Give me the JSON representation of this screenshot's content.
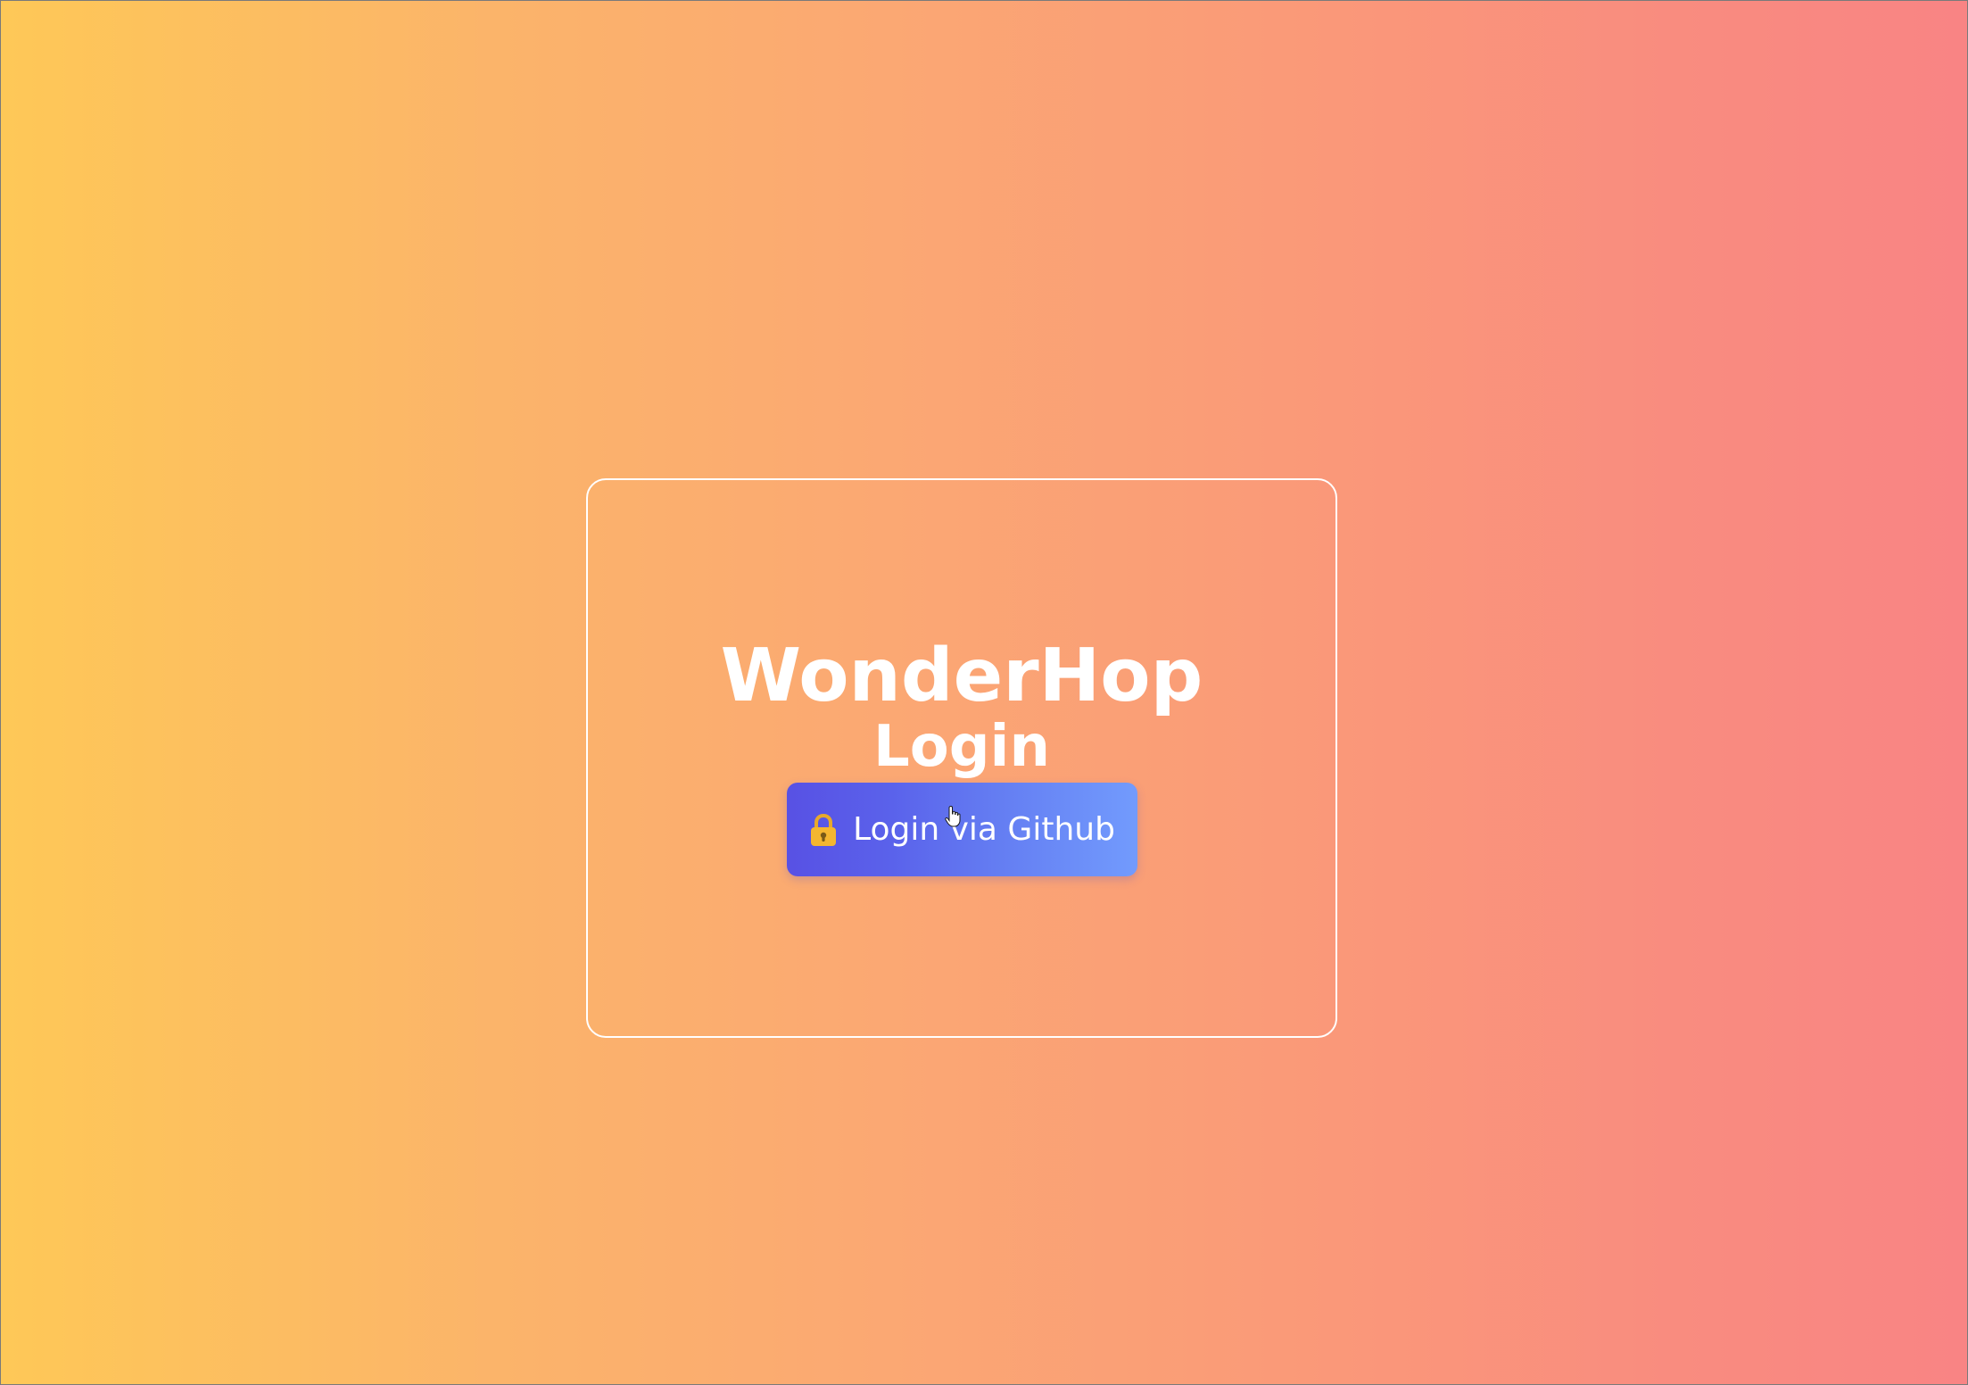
{
  "login_card": {
    "brand": "WonderHop",
    "subtitle": "Login",
    "github_button": {
      "label": "Login via Github",
      "icon": "lock-icon",
      "icon_color": "#f4b630"
    }
  },
  "colors": {
    "background_start": "#fec857",
    "background_end": "#f98484",
    "button_start": "#5851e4",
    "button_end": "#729bfd",
    "text": "#ffffff"
  },
  "cursor": {
    "icon": "hand-pointer-icon"
  }
}
